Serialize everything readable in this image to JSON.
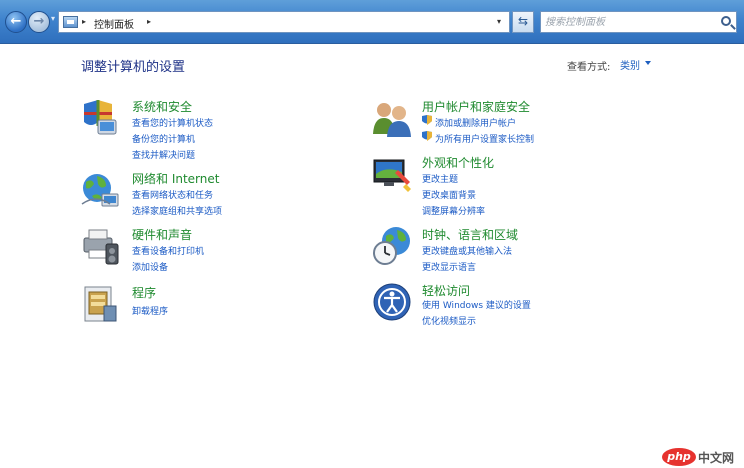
{
  "nav": {
    "back_glyph": "←",
    "forward_glyph": "→",
    "history_dropdown_glyph": "▾",
    "address": {
      "icon": "control-panel-icon",
      "sep_glyph": "▸",
      "crumb": "控制面板",
      "dropdown_glyph": "▾"
    },
    "refresh_glyph": "⇆",
    "search": {
      "placeholder": "搜索控制面板",
      "value": ""
    }
  },
  "header": {
    "title": "调整计算机的设置",
    "view_by_label": "查看方式:",
    "view_by_value": "类别"
  },
  "categories": {
    "system": {
      "icon": "system-security-icon",
      "title": "系统和安全",
      "links": [
        "查看您的计算机状态",
        "备份您的计算机",
        "查找并解决问题"
      ]
    },
    "network": {
      "icon": "network-icon",
      "title": "网络和 Internet",
      "links": [
        "查看网络状态和任务",
        "选择家庭组和共享选项"
      ]
    },
    "hardware": {
      "icon": "hardware-sound-icon",
      "title": "硬件和声音",
      "links": [
        "查看设备和打印机",
        "添加设备"
      ]
    },
    "programs": {
      "icon": "programs-icon",
      "title": "程序",
      "links": [
        "卸载程序"
      ]
    },
    "users": {
      "icon": "user-accounts-icon",
      "title": "用户帐户和家庭安全",
      "links": [
        "添加或删除用户帐户",
        "为所有用户设置家长控制"
      ]
    },
    "appearance": {
      "icon": "appearance-icon",
      "title": "外观和个性化",
      "links": [
        "更改主题",
        "更改桌面背景",
        "调整屏幕分辨率"
      ]
    },
    "clock": {
      "icon": "clock-region-icon",
      "title": "时钟、语言和区域",
      "links": [
        "更改键盘或其他输入法",
        "更改显示语言"
      ]
    },
    "ease": {
      "icon": "ease-of-access-icon",
      "title": "轻松访问",
      "links": [
        "使用 Windows 建议的设置",
        "优化视频显示"
      ]
    }
  },
  "watermark": {
    "badge": "php",
    "text": "中文网"
  },
  "colors": {
    "title_bar_top": "#5f9fd9",
    "title_bar_bottom": "#2f6fbd",
    "category_title": "#1f8a2f",
    "link": "#1c5bc5",
    "page_title": "#1e3287"
  }
}
